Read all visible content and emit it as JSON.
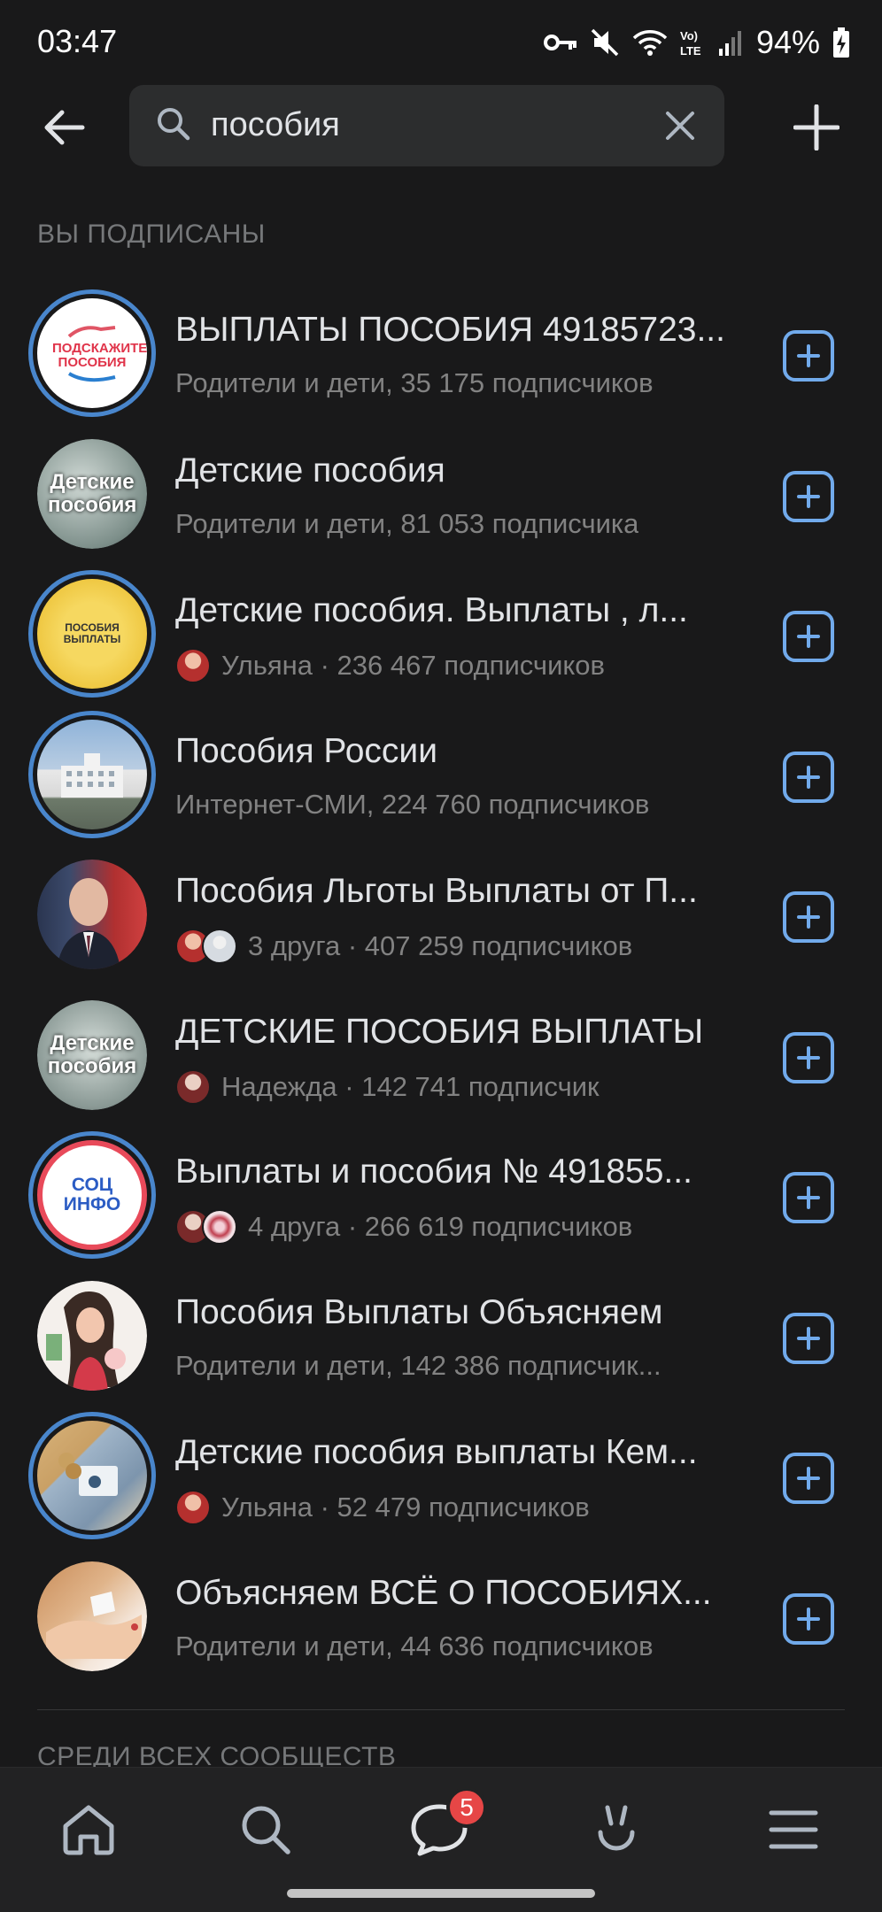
{
  "status_bar": {
    "time": "03:47",
    "battery": "94%"
  },
  "search": {
    "query": "пособия"
  },
  "section_subscribed": "ВЫ ПОДПИСАНЫ",
  "section_all": "СРЕДИ ВСЕХ СООБЩЕСТВ",
  "groups": [
    {
      "title": "ВЫПЛАТЫ ПОСОБИЯ 49185723...",
      "subtitle": "Родители и дети, 35 175 подписчиков",
      "avatar_text": "ПОДСКАЖИТЕ ПОСОБИЯ"
    },
    {
      "title": "Детские пособия",
      "subtitle": "Родители и дети, 81 053 подписчика",
      "avatar_text": "Детские пособия"
    },
    {
      "title": "Детские пособия.  Выплаты , л...",
      "subtitle": "Ульяна · 236 467 подписчиков",
      "avatar_text": "ПОСОБИЯ ВЫПЛАТЫ"
    },
    {
      "title": "Пособия России",
      "subtitle": "Интернет-СМИ, 224 760 подписчиков",
      "avatar_text": ""
    },
    {
      "title": "Пособия Льготы Выплаты от П...",
      "subtitle": "3 друга · 407 259 подписчиков",
      "avatar_text": ""
    },
    {
      "title": "ДЕТСКИЕ ПОСОБИЯ ВЫПЛАТЫ",
      "subtitle": "Надежда · 142 741 подписчик",
      "avatar_text": "Детские пособия"
    },
    {
      "title": "Выплаты и пособия № 491855...",
      "subtitle": "4 друга · 266 619 подписчиков",
      "avatar_text": "СОЦ ИНФО"
    },
    {
      "title": "Пособия Выплаты Объясняем",
      "subtitle": "Родители и дети, 142 386 подписчик...",
      "avatar_text": ""
    },
    {
      "title": "Детские пособия выплаты Кем...",
      "subtitle": "Ульяна · 52 479 подписчиков",
      "avatar_text": ""
    },
    {
      "title": "Объясняем ВСЁ О ПОСОБИЯХ...",
      "subtitle": "Родители и дети, 44 636 подписчиков",
      "avatar_text": ""
    }
  ],
  "nav": {
    "messages_badge": "5"
  },
  "colors": {
    "background": "#19191a",
    "accent": "#71aaeb",
    "story_ring": "#4986cc",
    "badge": "#e64646"
  }
}
